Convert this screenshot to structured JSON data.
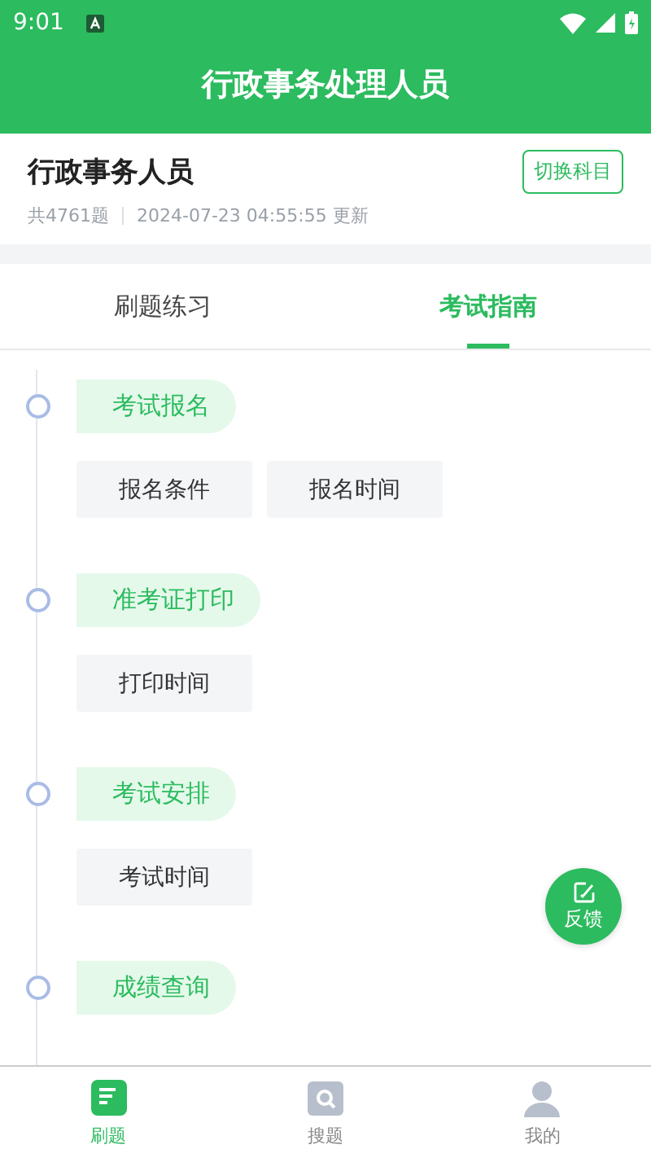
{
  "status_bar": {
    "time": "9:01"
  },
  "header": {
    "title": "行政事务处理人员"
  },
  "subject": {
    "name": "行政事务人员",
    "switch_button": "切换科目",
    "count": "共4761题",
    "updated": "2024-07-23 04:55:55 更新"
  },
  "tabs": [
    {
      "label": "刷题练习",
      "selected": false
    },
    {
      "label": "考试指南",
      "selected": true
    }
  ],
  "sections": [
    {
      "title": "考试报名",
      "items": [
        "报名条件",
        "报名时间"
      ]
    },
    {
      "title": "准考证打印",
      "items": [
        "打印时间"
      ]
    },
    {
      "title": "考试安排",
      "items": [
        "考试时间"
      ]
    },
    {
      "title": "成绩查询"
    }
  ],
  "feedback_button": "反馈",
  "bottom_nav": [
    {
      "label": "刷题",
      "kind": "practice",
      "selected": true
    },
    {
      "label": "搜题",
      "kind": "search",
      "selected": false
    },
    {
      "label": "我的",
      "kind": "profile",
      "selected": false
    }
  ]
}
